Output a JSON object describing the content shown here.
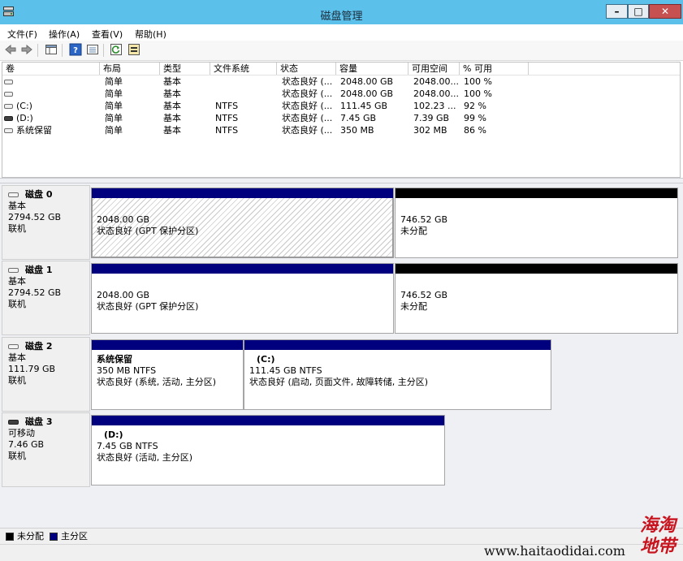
{
  "window": {
    "title": "磁盘管理",
    "minimize_label": "–",
    "maximize_label": "□",
    "close_label": "✕"
  },
  "menu": [
    "文件(F)",
    "操作(A)",
    "查看(V)",
    "帮助(H)"
  ],
  "toolbar": {
    "buttons": [
      "back-arrow-icon",
      "forward-arrow-icon",
      "console-tree-icon",
      "help-icon",
      "properties-icon",
      "refresh-icon",
      "rescan-icon"
    ]
  },
  "volume_list": {
    "columns": [
      "卷",
      "布局",
      "类型",
      "文件系统",
      "状态",
      "容量",
      "可用空间",
      "% 可用"
    ],
    "rows": [
      {
        "volume": "",
        "layout": "简单",
        "type": "基本",
        "fs": "",
        "status": "状态良好 (...",
        "capacity": "2048.00 GB",
        "free": "2048.00...",
        "pct": "100 %",
        "icon": "disk-volume-icon"
      },
      {
        "volume": "",
        "layout": "简单",
        "type": "基本",
        "fs": "",
        "status": "状态良好 (...",
        "capacity": "2048.00 GB",
        "free": "2048.00...",
        "pct": "100 %",
        "icon": "disk-volume-icon"
      },
      {
        "volume": "(C:)",
        "layout": "简单",
        "type": "基本",
        "fs": "NTFS",
        "status": "状态良好 (...",
        "capacity": "111.45 GB",
        "free": "102.23 ...",
        "pct": "92 %",
        "icon": "disk-volume-icon"
      },
      {
        "volume": "(D:)",
        "layout": "简单",
        "type": "基本",
        "fs": "NTFS",
        "status": "状态良好 (...",
        "capacity": "7.45 GB",
        "free": "7.39 GB",
        "pct": "99 %",
        "icon": "removable-volume-icon"
      },
      {
        "volume": "系统保留",
        "layout": "简单",
        "type": "基本",
        "fs": "NTFS",
        "status": "状态良好 (...",
        "capacity": "350 MB",
        "free": "302 MB",
        "pct": "86 %",
        "icon": "disk-volume-icon"
      }
    ]
  },
  "disks": [
    {
      "name": "磁盘 0",
      "type": "基本",
      "size": "2794.52 GB",
      "state": "联机",
      "partitions": [
        {
          "title": "",
          "line1": "2048.00 GB",
          "line2": "状态良好 (GPT 保护分区)",
          "kind": "gpt"
        },
        {
          "title": "",
          "line1": "746.52 GB",
          "line2": "未分配",
          "kind": "unallocated"
        }
      ]
    },
    {
      "name": "磁盘 1",
      "type": "基本",
      "size": "2794.52 GB",
      "state": "联机",
      "partitions": [
        {
          "title": "",
          "line1": "2048.00 GB",
          "line2": "状态良好 (GPT 保护分区)",
          "kind": "primary"
        },
        {
          "title": "",
          "line1": "746.52 GB",
          "line2": "未分配",
          "kind": "unallocated"
        }
      ]
    },
    {
      "name": "磁盘 2",
      "type": "基本",
      "size": "111.79 GB",
      "state": "联机",
      "partitions": [
        {
          "title": "系统保留",
          "line1": "350 MB NTFS",
          "line2": "状态良好 (系统, 活动, 主分区)",
          "kind": "primary"
        },
        {
          "title": "(C:)",
          "line1": "111.45 GB NTFS",
          "line2": "状态良好 (启动, 页面文件, 故障转储, 主分区)",
          "kind": "primary"
        }
      ]
    },
    {
      "name": "磁盘 3",
      "type": "可移动",
      "size": "7.46 GB",
      "state": "联机",
      "partitions": [
        {
          "title": "(D:)",
          "line1": "7.45 GB NTFS",
          "line2": "状态良好 (活动, 主分区)",
          "kind": "primary"
        }
      ]
    }
  ],
  "legend": [
    {
      "label": "未分配",
      "color": "#000000"
    },
    {
      "label": "主分区",
      "color": "#00007f"
    }
  ],
  "colors": {
    "titlebar": "#5bc0ea",
    "primary": "#00007f",
    "unallocated": "#000000"
  },
  "watermark": {
    "url": "www.haitaodidai.com",
    "logo": "海淘\n地带"
  }
}
